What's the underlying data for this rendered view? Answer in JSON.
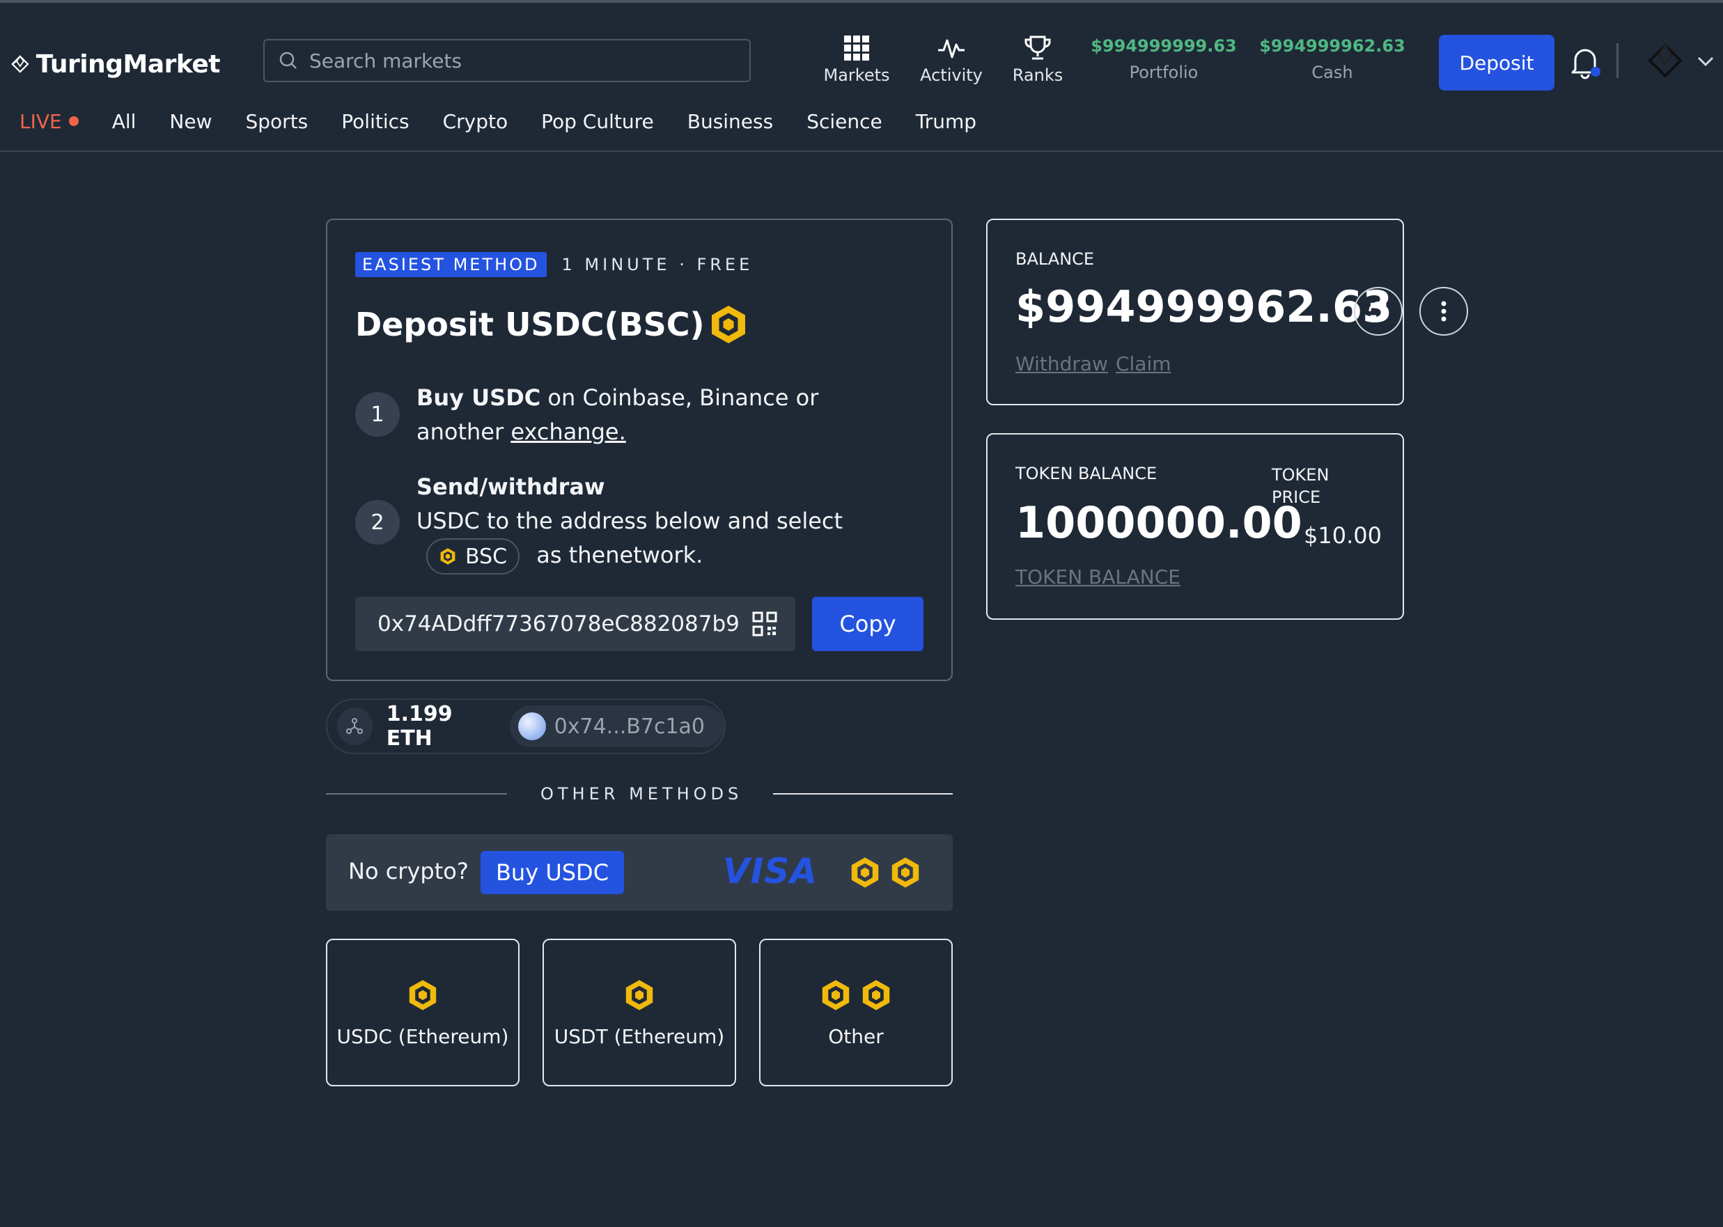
{
  "header": {
    "logo_text": "TuringMarket",
    "search_placeholder": "Search markets",
    "nav": [
      {
        "label": "Markets",
        "icon": "grid-icon"
      },
      {
        "label": "Activity",
        "icon": "pulse-icon"
      },
      {
        "label": "Ranks",
        "icon": "trophy-icon"
      }
    ],
    "portfolio": {
      "value": "$994999999.63",
      "label": "Portfolio"
    },
    "cash": {
      "value": "$994999962.63",
      "label": "Cash"
    },
    "deposit_label": "Deposit",
    "colors": {
      "accent": "#2453e0",
      "positive": "#4fb882",
      "live": "#f0644a"
    }
  },
  "categories": {
    "live": "LIVE",
    "items": [
      "All",
      "New",
      "Sports",
      "Politics",
      "Crypto",
      "Pop Culture",
      "Business",
      "Science",
      "Trump"
    ]
  },
  "deposit": {
    "badge": "EASIEST METHOD",
    "meta": "1 MINUTE · FREE",
    "title": "Deposit USDC(BSC)",
    "step1": {
      "num": "1",
      "bold": "Buy USDC",
      "text": " on Coinbase, Binance or",
      "line2": "another ",
      "link": "exchange."
    },
    "step2": {
      "num": "2",
      "bold": "Send/withdraw",
      "line2": "USDC to the address below and select",
      "network": "BSC",
      "after": "as thenetwork."
    },
    "address": "0x74ADdff77367078eC882087b9",
    "copy_label": "Copy"
  },
  "wallet": {
    "eth": "1.199 ETH",
    "address": "0x74...B7c1a0"
  },
  "other_methods": {
    "label": "OTHER METHODS",
    "no_crypto": "No crypto?",
    "buy_label": "Buy USDC",
    "visa": "VISA",
    "options": [
      {
        "label": "USDC (Ethereum)"
      },
      {
        "label": "USDT (Ethereum)"
      },
      {
        "label": "Other"
      }
    ]
  },
  "balance": {
    "label": "BALANCE",
    "value": "$994999962.63",
    "withdraw": "Withdraw",
    "claim": "Claim"
  },
  "token": {
    "label": "TOKEN BALANCE",
    "value": "1000000.00",
    "price_label_1": "TOKEN",
    "price_label_2": "PRICE",
    "price": "$10.00",
    "link": "TOKEN BALANCE"
  }
}
